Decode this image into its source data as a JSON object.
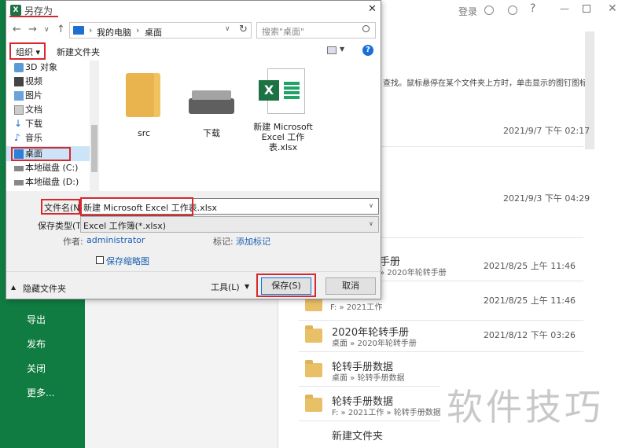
{
  "background": {
    "win_controls": {
      "login": "登录"
    },
    "hint_text": "查找。鼠标悬停在某个文件夹上方时，单击显示的图钉图标。",
    "green_menu": [
      {
        "label": "导出"
      },
      {
        "label": "发布"
      },
      {
        "label": "关闭"
      },
      {
        "label": "更多..."
      }
    ],
    "dates_top": [
      "2021/9/7 下午 02:17",
      "2021/9/3 下午 04:29"
    ],
    "recent": [
      {
        "title": "手册",
        "path": "» 2020年轮转手册",
        "date": "2021/8/25 上午 11:46"
      },
      {
        "title": "",
        "path": "F: » 2021工作",
        "date": "2021/8/25 上午 11:46"
      },
      {
        "title": "2020年轮转手册",
        "path": "桌面 » 2020年轮转手册",
        "date": "2021/8/12 下午 03:26"
      },
      {
        "title": "轮转手册数据",
        "path": "桌面 » 轮转手册数据",
        "date": ""
      },
      {
        "title": "轮转手册数据",
        "path": "F: » 2021工作 » 轮转手册数据",
        "date": ""
      },
      {
        "title": "新建文件夹",
        "path": "",
        "date": ""
      }
    ],
    "watermark": "软件技巧"
  },
  "dialog": {
    "title": "另存为",
    "address": {
      "sep1": "›",
      "pc": "我的电脑",
      "sep2": "›",
      "current": "桌面"
    },
    "search_placeholder": "搜索\"桌面\"",
    "toolbar": {
      "organize": "组织 ▾",
      "new_folder": "新建文件夹"
    },
    "nav_items": [
      {
        "label": "3D 对象",
        "icon": "3d-objects-icon"
      },
      {
        "label": "视频",
        "icon": "video-icon"
      },
      {
        "label": "图片",
        "icon": "pictures-icon"
      },
      {
        "label": "文档",
        "icon": "documents-icon"
      },
      {
        "label": "下载",
        "icon": "downloads-icon"
      },
      {
        "label": "音乐",
        "icon": "music-icon"
      },
      {
        "label": "桌面",
        "icon": "desktop-icon"
      },
      {
        "label": "本地磁盘 (C:)",
        "icon": "drive-icon"
      },
      {
        "label": "本地磁盘 (D:)",
        "icon": "drive-icon"
      }
    ],
    "files": [
      {
        "name": "src",
        "icon": "folder-icon"
      },
      {
        "name": "下载",
        "icon": "drive-icon"
      },
      {
        "name": "新建 Microsoft Excel 工作表.xlsx",
        "icon": "excel-file-icon"
      }
    ],
    "filename_label": "文件名(N):",
    "filename_value": "新建 Microsoft Excel 工作表.xlsx",
    "type_label": "保存类型(T):",
    "type_value": "Excel 工作簿(*.xlsx)",
    "author_label": "作者:",
    "author_value": "administrator",
    "tags_label": "标记:",
    "tags_value": "添加标记",
    "thumbnail_label": "保存缩略图",
    "hide_folders": "隐藏文件夹",
    "tools": "工具(L)",
    "save": "保存(S)",
    "cancel": "取消"
  },
  "colors": {
    "excel_green": "#107c41",
    "highlight_red": "#d8282e",
    "link_blue": "#1a5fb4"
  }
}
